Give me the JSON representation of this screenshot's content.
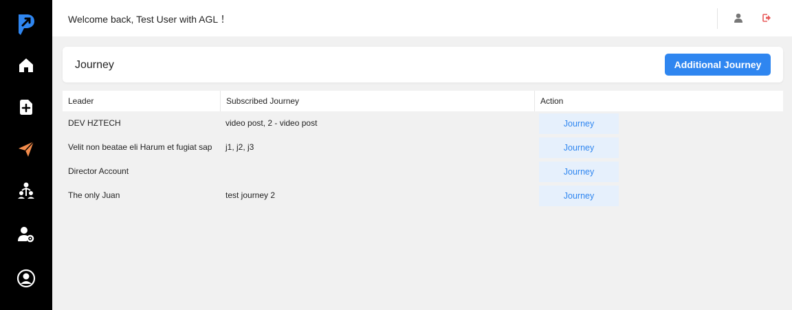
{
  "header": {
    "welcome": "Welcome back, Test User with AGL ！"
  },
  "sidebar": {
    "items": [
      {
        "icon": "home-icon"
      },
      {
        "icon": "add-file-icon"
      },
      {
        "icon": "send-icon",
        "active": true
      },
      {
        "icon": "users-network-icon"
      },
      {
        "icon": "user-settings-icon"
      },
      {
        "icon": "user-circle-icon"
      }
    ],
    "active_color": "#f28b4b"
  },
  "page": {
    "title": "Journey",
    "add_button_label": "Additional Journey"
  },
  "table": {
    "columns": [
      "Leader",
      "Subscribed Journey",
      "Action"
    ],
    "rows": [
      {
        "leader": "DEV HZTECH",
        "journeys": "video post, 2 - video post",
        "action": "Journey"
      },
      {
        "leader": "Velit non beatae eli Harum et fugiat sap",
        "journeys": "j1, j2, j3",
        "action": "Journey"
      },
      {
        "leader": "Director Account",
        "journeys": "",
        "action": "Journey"
      },
      {
        "leader": "The only  Juan",
        "journeys": "test journey 2",
        "action": "Journey"
      }
    ]
  },
  "colors": {
    "accent": "#2f86f0",
    "logout": "#e85a5a"
  }
}
